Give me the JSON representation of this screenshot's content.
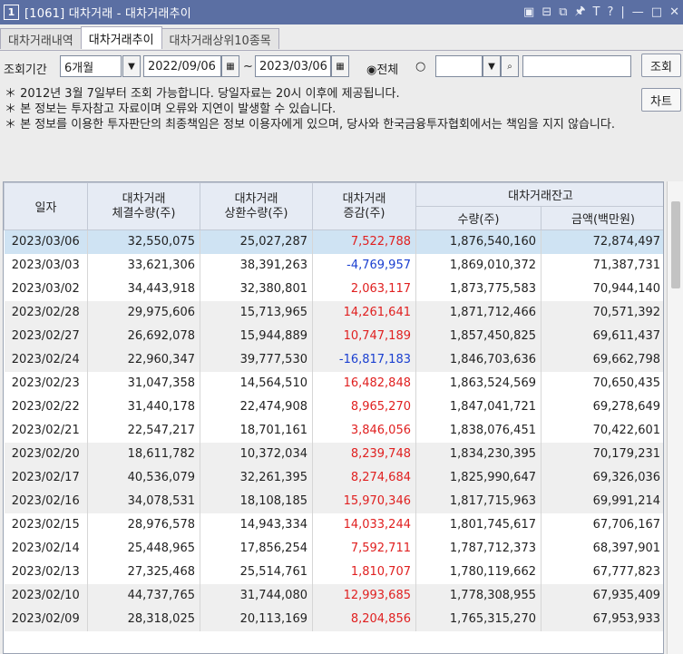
{
  "title": {
    "badge": "1",
    "text": "[1061] 대차거래 - 대차거래추이"
  },
  "window_controls": [
    "▣",
    "⊟",
    "⧉",
    "🖈",
    "T",
    "?",
    "|",
    "—",
    "□",
    "✕"
  ],
  "tabs": [
    {
      "label": "대차거래내역"
    },
    {
      "label": "대차거래추이"
    },
    {
      "label": "대차거래상위10종목"
    }
  ],
  "filter": {
    "period_label": "조회기간",
    "period_value": "6개월",
    "start_date": "2022/09/06",
    "tilde": "~",
    "end_date": "2023/03/06",
    "radio_all": "◉전체",
    "radio_other": "○",
    "search_button": "조회",
    "chart_button": "차트"
  },
  "notes": [
    "＊ 2012년 3월 7일부터 조회 가능합니다. 당일자료는 20시 이후에 제공됩니다.",
    "＊ 본 정보는 투자참고 자료이며 오류와 지연이 발생할 수 있습니다.",
    "＊ 본 정보를 이용한 투자판단의 최종책임은 정보 이용자에게 있으며, 당사와 한국금융투자협회에서는 책임을 지지 않습니다."
  ],
  "table": {
    "headers": {
      "date": "일자",
      "executed": "대차거래\n체결수량(주)",
      "repaid": "대차거래\n상환수량(주)",
      "change": "대차거래\n증감(주)",
      "balance": "대차거래잔고",
      "qty": "수량(주)",
      "amount": "금액(백만원)"
    },
    "rows": [
      [
        "2023/03/06",
        "32,550,075",
        "25,027,287",
        "7,522,788",
        "1,876,540,160",
        "72,874,497"
      ],
      [
        "2023/03/03",
        "33,621,306",
        "38,391,263",
        "-4,769,957",
        "1,869,010,372",
        "71,387,731"
      ],
      [
        "2023/03/02",
        "34,443,918",
        "32,380,801",
        "2,063,117",
        "1,873,775,583",
        "70,944,140"
      ],
      [
        "2023/02/28",
        "29,975,606",
        "15,713,965",
        "14,261,641",
        "1,871,712,466",
        "70,571,392"
      ],
      [
        "2023/02/27",
        "26,692,078",
        "15,944,889",
        "10,747,189",
        "1,857,450,825",
        "69,611,437"
      ],
      [
        "2023/02/24",
        "22,960,347",
        "39,777,530",
        "-16,817,183",
        "1,846,703,636",
        "69,662,798"
      ],
      [
        "2023/02/23",
        "31,047,358",
        "14,564,510",
        "16,482,848",
        "1,863,524,569",
        "70,650,435"
      ],
      [
        "2023/02/22",
        "31,440,178",
        "22,474,908",
        "8,965,270",
        "1,847,041,721",
        "69,278,649"
      ],
      [
        "2023/02/21",
        "22,547,217",
        "18,701,161",
        "3,846,056",
        "1,838,076,451",
        "70,422,601"
      ],
      [
        "2023/02/20",
        "18,611,782",
        "10,372,034",
        "8,239,748",
        "1,834,230,395",
        "70,179,231"
      ],
      [
        "2023/02/17",
        "40,536,079",
        "32,261,395",
        "8,274,684",
        "1,825,990,647",
        "69,326,036"
      ],
      [
        "2023/02/16",
        "34,078,531",
        "18,108,185",
        "15,970,346",
        "1,817,715,963",
        "69,991,214"
      ],
      [
        "2023/02/15",
        "28,976,578",
        "14,943,334",
        "14,033,244",
        "1,801,745,617",
        "67,706,167"
      ],
      [
        "2023/02/14",
        "25,448,965",
        "17,856,254",
        "7,592,711",
        "1,787,712,373",
        "68,397,901"
      ],
      [
        "2023/02/13",
        "27,325,468",
        "25,514,761",
        "1,810,707",
        "1,780,119,662",
        "67,777,823"
      ],
      [
        "2023/02/10",
        "44,737,765",
        "31,744,080",
        "12,993,685",
        "1,778,308,955",
        "67,935,409"
      ],
      [
        "2023/02/09",
        "28,318,025",
        "20,113,169",
        "8,204,856",
        "1,765,315,270",
        "67,953,933"
      ]
    ]
  },
  "colors": {
    "title_bar": "#5b6fa3",
    "positive": "#e02020",
    "negative": "#1a3fd0",
    "selected_row": "#cfe3f3",
    "header_bg": "#e6ebf4"
  }
}
